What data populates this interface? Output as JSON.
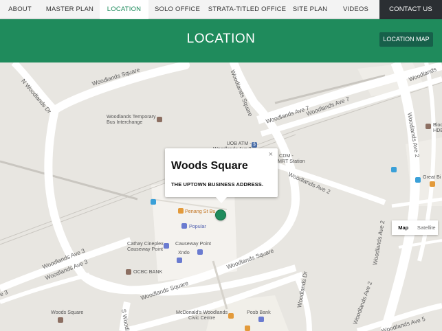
{
  "nav": {
    "items": [
      {
        "label": "ABOUT"
      },
      {
        "label": "MASTER PLAN"
      },
      {
        "label": "LOCATION"
      },
      {
        "label": "SOLO OFFICE"
      },
      {
        "label": "STRATA-TITLED OFFICE"
      },
      {
        "label": "SITE PLAN"
      },
      {
        "label": "VIDEOS"
      },
      {
        "label": "CONTACT US"
      }
    ]
  },
  "banner": {
    "title": "LOCATION",
    "location_map_label": "LOCATION MAP"
  },
  "map": {
    "roads": {
      "woodlands_sq_top": "Woodlands Square",
      "n_woodlands_dr": "N Woodlands Dr",
      "woodlands_sq_vertical": "Woodlands Square",
      "woodlands_ave7_a": "Woodlands Ave 7",
      "woodlands_ave7_b": "Woodlands Ave 7",
      "woodlands_ave2_diag": "Woodlands Ave 2",
      "woodlands_ave2_right": "Woodlands Ave 2",
      "woodlands_ave2_bottom": "Woodlands Ave 2",
      "woodlands_ave2_lower": "Woodlands Ave 2",
      "woodlands_ave3_a": "Woodlands Ave 3",
      "woodlands_ave3_b": "Woodlands Ave 3",
      "woodlands_ave3_c": "e 3",
      "woodlands_sq_bottom": "Woodlands Square",
      "woodlands_sq_right": "Woodlands Square",
      "woodlands_dr": "Woodlands Dr",
      "s_woodlands": "S Woodla",
      "woodlands_ave5": "Woodlands Ave 5",
      "woodlands_top_right": "Woodlands"
    },
    "places": {
      "bus_interchange": "Woodlands Temporary\nBus Interchange",
      "uob_atm": "UOB ATM -\nWoodlands Ave 2",
      "cdm": "CDM -",
      "mrt": "MRT Station",
      "penang": "Penang St Bu",
      "popular": "Popular",
      "cathay": "Cathay Cineplex\nCauseway Point",
      "causeway": "Causeway Point",
      "xndo": "Xndo",
      "ocbc": "OCBC BANK",
      "woods": "Woods Square",
      "mcdonalds": "McDonald's Woodlands\nCivic Centre",
      "posb": "Posb Bank",
      "bloc": "Bloc",
      "hde": "HDE",
      "great": "Great Bi"
    },
    "popup": {
      "title": "Woods Square",
      "subtitle": "THE UPTOWN BUSINESS ADDRESS.",
      "close": "×"
    },
    "map_type": {
      "map": "Map",
      "satellite": "Satellite",
      "selected": "Map"
    },
    "colors": {
      "accent": "#1f8b5c",
      "land": "#e8e6e1",
      "road": "#ffffff",
      "block": "#f3f1ec"
    }
  }
}
